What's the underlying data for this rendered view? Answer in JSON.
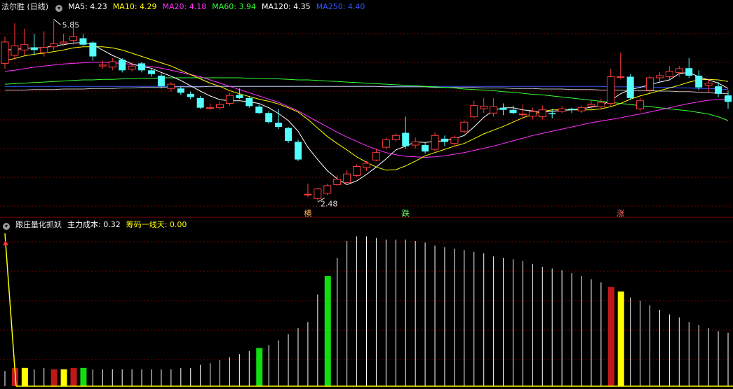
{
  "header_main": {
    "stock_name": "法尔胜 (日线)",
    "ma_items": [
      {
        "label": "MA5: 4.23",
        "color": "#ffffff"
      },
      {
        "label": "MA10: 4.29",
        "color": "#ffff00"
      },
      {
        "label": "MA20: 4.18",
        "color": "#ff33ff"
      },
      {
        "label": "MA60: 3.94",
        "color": "#33ff33"
      },
      {
        "label": "MA120: 4.35",
        "color": "#ffffff"
      },
      {
        "label": "MA250: 4.40",
        "color": "#3355ff"
      }
    ]
  },
  "header_sub": {
    "indicator_name": "跟庄量化抓妖",
    "items": [
      {
        "label": "主力成本: 0.32",
        "color": "#ffffff"
      },
      {
        "label": "筹码一线天: 0.00",
        "color": "#ffff00"
      }
    ]
  },
  "annotations": {
    "high_label": "5.85",
    "low_label": "2.48",
    "markers": [
      "横",
      "跌",
      "涨"
    ]
  },
  "colors": {
    "up": "#ff3c3c",
    "down": "#54ffff",
    "grid": "#7a0000",
    "ma5": "#ffffff",
    "ma10": "#ffff00",
    "ma20": "#ff33ff",
    "ma60": "#33ff33",
    "ma120": "#c0c0c0",
    "ma250": "#3355ff",
    "bar_red": "#c01818",
    "bar_yellow": "#ffff00",
    "bar_green": "#11dd11"
  },
  "chart_data": [
    {
      "type": "candlestick",
      "title": "法尔胜 (日线)",
      "ylim": [
        2.3,
        6.0
      ],
      "candles": [
        [
          5.05,
          5.45,
          5.55,
          4.95
        ],
        [
          5.2,
          5.38,
          5.8,
          5.12
        ],
        [
          5.3,
          5.4,
          5.7,
          5.2
        ],
        [
          5.35,
          5.3,
          5.6,
          5.2
        ],
        [
          5.25,
          5.35,
          5.65,
          5.18
        ],
        [
          5.36,
          5.42,
          5.85,
          5.3
        ],
        [
          5.42,
          5.45,
          5.6,
          5.38
        ],
        [
          5.48,
          5.55,
          5.85,
          5.4
        ],
        [
          5.52,
          5.4,
          5.6,
          5.38
        ],
        [
          5.44,
          5.18,
          5.46,
          5.1
        ],
        [
          5.0,
          5.02,
          5.1,
          4.95
        ],
        [
          4.98,
          5.08,
          5.15,
          4.92
        ],
        [
          5.12,
          4.92,
          5.15,
          4.88
        ],
        [
          4.94,
          5.0,
          5.08,
          4.9
        ],
        [
          5.05,
          4.92,
          5.08,
          4.88
        ],
        [
          4.92,
          4.85,
          4.96,
          4.8
        ],
        [
          4.82,
          4.62,
          4.86,
          4.58
        ],
        [
          4.58,
          4.66,
          4.7,
          4.52
        ],
        [
          4.58,
          4.5,
          4.62,
          4.46
        ],
        [
          4.48,
          4.42,
          4.52,
          4.38
        ],
        [
          4.4,
          4.22,
          4.44,
          4.2
        ],
        [
          4.22,
          4.22,
          4.3,
          4.18
        ],
        [
          4.22,
          4.28,
          4.34,
          4.18
        ],
        [
          4.3,
          4.45,
          4.5,
          4.26
        ],
        [
          4.46,
          4.4,
          4.58,
          4.38
        ],
        [
          4.4,
          4.25,
          4.44,
          4.22
        ],
        [
          4.24,
          4.12,
          4.28,
          4.1
        ],
        [
          4.12,
          3.95,
          4.16,
          3.92
        ],
        [
          3.94,
          3.86,
          4.2,
          3.82
        ],
        [
          3.84,
          3.6,
          3.86,
          3.56
        ],
        [
          3.58,
          3.25,
          3.62,
          3.22
        ],
        [
          2.6,
          2.6,
          2.8,
          2.55
        ],
        [
          2.52,
          2.7,
          2.72,
          2.48
        ],
        [
          2.62,
          2.76,
          2.8,
          2.58
        ],
        [
          2.78,
          2.88,
          2.95,
          2.76
        ],
        [
          2.82,
          2.98,
          3.05,
          2.8
        ],
        [
          2.95,
          3.12,
          3.16,
          2.92
        ],
        [
          3.1,
          3.18,
          3.22,
          3.04
        ],
        [
          3.24,
          3.38,
          3.45,
          3.22
        ],
        [
          3.48,
          3.62,
          3.66,
          3.44
        ],
        [
          3.62,
          3.7,
          3.74,
          3.58
        ],
        [
          3.75,
          3.5,
          4.05,
          3.45
        ],
        [
          3.52,
          3.58,
          3.66,
          3.46
        ],
        [
          3.52,
          3.4,
          3.56,
          3.36
        ],
        [
          3.44,
          3.7,
          3.76,
          3.4
        ],
        [
          3.64,
          3.58,
          3.7,
          3.5
        ],
        [
          3.55,
          3.66,
          3.7,
          3.5
        ],
        [
          3.78,
          3.95,
          3.98,
          3.74
        ],
        [
          4.05,
          4.26,
          4.35,
          4.02
        ],
        [
          4.2,
          4.25,
          4.4,
          4.12
        ],
        [
          4.12,
          4.24,
          4.4,
          4.05
        ],
        [
          4.22,
          4.18,
          4.3,
          4.08
        ],
        [
          4.18,
          4.12,
          4.26,
          4.1
        ],
        [
          4.1,
          4.1,
          4.28,
          4.02
        ],
        [
          4.06,
          4.15,
          4.22,
          4.0
        ],
        [
          4.05,
          4.18,
          4.26,
          4.0
        ],
        [
          4.12,
          4.1,
          4.2,
          4.02
        ],
        [
          4.15,
          4.2,
          4.25,
          4.12
        ],
        [
          4.2,
          4.18,
          4.22,
          4.12
        ],
        [
          4.16,
          4.22,
          4.26,
          4.12
        ],
        [
          4.25,
          4.28,
          4.36,
          4.2
        ],
        [
          4.24,
          4.32,
          4.38,
          4.18
        ],
        [
          4.3,
          4.8,
          4.95,
          4.25
        ],
        [
          4.8,
          4.8,
          5.25,
          4.75
        ],
        [
          4.8,
          4.4,
          4.85,
          4.36
        ],
        [
          4.2,
          4.35,
          4.4,
          4.15
        ],
        [
          4.55,
          4.78,
          4.82,
          4.5
        ],
        [
          4.78,
          4.82,
          4.88,
          4.7
        ],
        [
          4.8,
          4.9,
          5.0,
          4.75
        ],
        [
          4.88,
          4.95,
          5.0,
          4.8
        ],
        [
          4.96,
          4.82,
          5.15,
          4.78
        ],
        [
          4.82,
          4.6,
          4.92,
          4.55
        ],
        [
          4.64,
          4.68,
          4.76,
          4.5
        ],
        [
          4.62,
          4.48,
          4.7,
          4.42
        ],
        [
          4.45,
          4.33,
          4.54,
          4.2
        ]
      ],
      "ma5": [
        5.3,
        5.31,
        5.33,
        5.34,
        5.34,
        5.38,
        5.4,
        5.43,
        5.44,
        5.4,
        5.3,
        5.2,
        5.12,
        5.04,
        4.99,
        4.96,
        4.88,
        4.81,
        4.73,
        4.63,
        4.53,
        4.44,
        4.37,
        4.35,
        4.35,
        4.33,
        4.3,
        4.22,
        4.11,
        3.98,
        3.78,
        3.48,
        3.25,
        3.04,
        2.89,
        2.78,
        2.85,
        2.97,
        3.11,
        3.26,
        3.43,
        3.5,
        3.58,
        3.57,
        3.59,
        3.6,
        3.64,
        3.7,
        3.86,
        4.04,
        4.17,
        4.22,
        4.22,
        4.18,
        4.16,
        4.14,
        4.15,
        4.17,
        4.18,
        4.2,
        4.23,
        4.26,
        4.36,
        4.48,
        4.56,
        4.6,
        4.65,
        4.7,
        4.74,
        4.86,
        4.88,
        4.8,
        4.74,
        4.68,
        4.58
      ],
      "ma10": [
        5.1,
        5.14,
        5.19,
        5.22,
        5.24,
        5.27,
        5.3,
        5.34,
        5.36,
        5.36,
        5.36,
        5.34,
        5.3,
        5.24,
        5.18,
        5.12,
        5.06,
        5.0,
        4.92,
        4.84,
        4.76,
        4.68,
        4.62,
        4.54,
        4.48,
        4.43,
        4.38,
        4.34,
        4.29,
        4.22,
        4.14,
        4.0,
        3.84,
        3.68,
        3.55,
        3.43,
        3.3,
        3.2,
        3.11,
        3.05,
        3.06,
        3.13,
        3.22,
        3.32,
        3.38,
        3.44,
        3.5,
        3.55,
        3.64,
        3.73,
        3.8,
        3.87,
        3.95,
        4.03,
        4.1,
        4.15,
        4.18,
        4.18,
        4.18,
        4.18,
        4.18,
        4.2,
        4.24,
        4.3,
        4.38,
        4.44,
        4.49,
        4.54,
        4.59,
        4.64,
        4.7,
        4.74,
        4.75,
        4.74,
        4.71
      ],
      "ma20": [
        4.9,
        4.92,
        4.95,
        4.98,
        5.0,
        5.02,
        5.04,
        5.05,
        5.06,
        5.07,
        5.07,
        5.06,
        5.05,
        5.03,
        5.01,
        4.99,
        4.96,
        4.92,
        4.88,
        4.84,
        4.8,
        4.74,
        4.68,
        4.62,
        4.56,
        4.5,
        4.44,
        4.38,
        4.32,
        4.24,
        4.16,
        4.06,
        3.96,
        3.86,
        3.76,
        3.67,
        3.59,
        3.51,
        3.44,
        3.38,
        3.34,
        3.31,
        3.3,
        3.29,
        3.3,
        3.32,
        3.35,
        3.38,
        3.42,
        3.46,
        3.5,
        3.55,
        3.6,
        3.65,
        3.7,
        3.74,
        3.78,
        3.82,
        3.86,
        3.9,
        3.94,
        3.97,
        4.0,
        4.03,
        4.07,
        4.1,
        4.14,
        4.18,
        4.22,
        4.26,
        4.3,
        4.33,
        4.36,
        4.37,
        4.38
      ],
      "ma60": [
        4.66,
        4.67,
        4.68,
        4.69,
        4.7,
        4.71,
        4.72,
        4.73,
        4.74,
        4.74,
        4.75,
        4.75,
        4.76,
        4.76,
        4.77,
        4.77,
        4.78,
        4.78,
        4.78,
        4.78,
        4.78,
        4.78,
        4.78,
        4.78,
        4.78,
        4.77,
        4.77,
        4.76,
        4.76,
        4.75,
        4.74,
        4.74,
        4.73,
        4.72,
        4.71,
        4.7,
        4.69,
        4.68,
        4.67,
        4.66,
        4.65,
        4.64,
        4.63,
        4.62,
        4.61,
        4.6,
        4.59,
        4.57,
        4.56,
        4.55,
        4.54,
        4.52,
        4.51,
        4.49,
        4.47,
        4.46,
        4.44,
        4.42,
        4.4,
        4.38,
        4.36,
        4.34,
        4.32,
        4.3,
        4.28,
        4.26,
        4.24,
        4.22,
        4.2,
        4.18,
        4.16,
        4.13,
        4.1,
        4.05,
        3.98
      ],
      "ma120": [
        4.55,
        4.55,
        4.55,
        4.56,
        4.56,
        4.56,
        4.57,
        4.57,
        4.57,
        4.58,
        4.58,
        4.58,
        4.59,
        4.59,
        4.6,
        4.6,
        4.6,
        4.61,
        4.61,
        4.61,
        4.61,
        4.62,
        4.62,
        4.62,
        4.62,
        4.62,
        4.62,
        4.62,
        4.62,
        4.62,
        4.62,
        4.62,
        4.62,
        4.62,
        4.62,
        4.62,
        4.62,
        4.62,
        4.62,
        4.61,
        4.61,
        4.61,
        4.61,
        4.61,
        4.6,
        4.6,
        4.6,
        4.6,
        4.6,
        4.59,
        4.59,
        4.59,
        4.58,
        4.58,
        4.58,
        4.57,
        4.57,
        4.57,
        4.56,
        4.56,
        4.56,
        4.55,
        4.55,
        4.55,
        4.54,
        4.54,
        4.54,
        4.53,
        4.53,
        4.52,
        4.52,
        4.51,
        4.5,
        4.49,
        4.48
      ],
      "ma250": [
        4.62,
        4.62,
        4.62,
        4.62,
        4.62,
        4.62,
        4.62,
        4.62,
        4.62,
        4.62,
        4.62,
        4.62,
        4.62,
        4.62,
        4.62,
        4.62,
        4.62,
        4.62,
        4.62,
        4.62,
        4.62,
        4.62,
        4.62,
        4.62,
        4.62,
        4.62,
        4.62,
        4.62,
        4.62,
        4.62,
        4.62,
        4.62,
        4.62,
        4.62,
        4.62,
        4.62,
        4.62,
        4.62,
        4.62,
        4.62,
        4.62,
        4.62,
        4.62,
        4.62,
        4.62,
        4.62,
        4.62,
        4.62,
        4.62,
        4.62,
        4.62,
        4.62,
        4.62,
        4.62,
        4.62,
        4.62,
        4.62,
        4.62,
        4.62,
        4.62,
        4.62,
        4.62,
        4.61,
        4.61,
        4.61,
        4.61,
        4.6,
        4.6,
        4.6,
        4.59,
        4.59,
        4.58,
        4.58,
        4.57,
        4.56
      ]
    },
    {
      "type": "bar",
      "title": "跟庄量化抓妖",
      "values": [
        10,
        12,
        12,
        11,
        12,
        11,
        11,
        12,
        12,
        11,
        11,
        11,
        11,
        11,
        11,
        11,
        11,
        11,
        12,
        12,
        14,
        15,
        17,
        19,
        21,
        23,
        25,
        27,
        30,
        34,
        38,
        42,
        60,
        72,
        84,
        95,
        98,
        98,
        97,
        96,
        96,
        96,
        95,
        94,
        92,
        91,
        90,
        89,
        88,
        87,
        85,
        84,
        83,
        82,
        80,
        78,
        77,
        76,
        74,
        72,
        70,
        68,
        65,
        62,
        58,
        56,
        53,
        50,
        47,
        45,
        42,
        40,
        38,
        36,
        35
      ],
      "colors": [
        "white",
        "red",
        "yellow",
        "white",
        "white",
        "red",
        "yellow",
        "red",
        "green",
        "white",
        "white",
        "white",
        "white",
        "white",
        "white",
        "white",
        "white",
        "white",
        "white",
        "white",
        "white",
        "white",
        "white",
        "white",
        "white",
        "white",
        "green",
        "white",
        "white",
        "white",
        "white",
        "white",
        "white",
        "green",
        "white",
        "white",
        "white",
        "white",
        "white",
        "white",
        "white",
        "white",
        "white",
        "white",
        "white",
        "white",
        "white",
        "white",
        "white",
        "white",
        "white",
        "white",
        "white",
        "white",
        "white",
        "white",
        "white",
        "white",
        "white",
        "white",
        "white",
        "white",
        "red",
        "yellow",
        "white",
        "white",
        "white",
        "white",
        "white",
        "white",
        "white",
        "white",
        "white",
        "white",
        "white"
      ],
      "cost_line_start": 100,
      "cost_line_end": 0,
      "ylim": [
        0,
        100
      ]
    }
  ]
}
